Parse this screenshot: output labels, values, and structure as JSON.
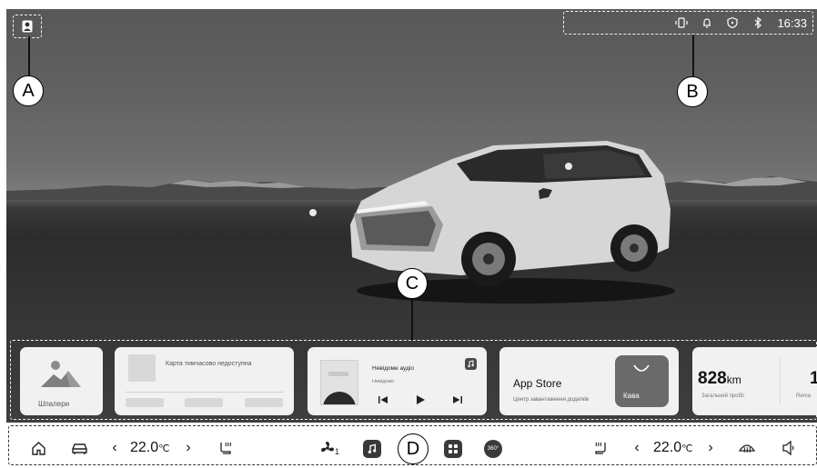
{
  "callouts": {
    "a": "A",
    "b": "B",
    "c": "C",
    "d": "D"
  },
  "status": {
    "time": "16:33"
  },
  "cards": {
    "wallpaper_label": "Шпалери",
    "map_label": "Карта тимчасово недоступна",
    "audio": {
      "title": "Невідоме аудіо",
      "artist": "Невідомо"
    },
    "app_store": {
      "title": "App Store",
      "subtitle": "Центр завантаження додатків",
      "tile_label": "Кава"
    },
    "odometer": {
      "value": "828",
      "unit": "km",
      "label": "Загальний пробіг",
      "next_value": "1",
      "next_label": "Rema"
    }
  },
  "dock": {
    "left_temp": "22.0",
    "right_temp": "22.0",
    "temp_unit": "℃",
    "fan_level": "1",
    "cam_label": "360°"
  }
}
